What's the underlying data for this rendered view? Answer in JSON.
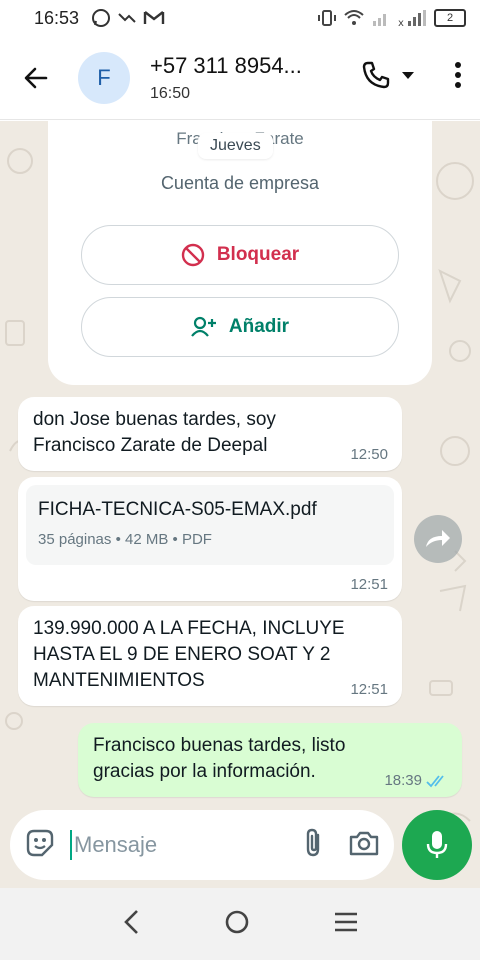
{
  "status_bar": {
    "time": "16:53",
    "battery": "2"
  },
  "header": {
    "avatar_initial": "F",
    "contact_name": "+57 311 8954...",
    "last_seen": "16:50"
  },
  "info_card": {
    "name": "Francisco Zarate",
    "date_chip": "Jueves",
    "account_type": "Cuenta de empresa",
    "block_label": "Bloquear",
    "add_label": "Añadir"
  },
  "messages": [
    {
      "direction": "in",
      "text_line1": "don Jose buenas tardes, soy",
      "text_line2": "Francisco Zarate de Deepal",
      "time": "12:50"
    },
    {
      "direction": "in",
      "file_name": "FICHA-TECNICA-S05-EMAX.pdf",
      "pages": "35 páginas",
      "size": "42 MB",
      "type": "PDF",
      "time": "12:51"
    },
    {
      "direction": "in",
      "text_line1": "139.990.000 A LA FECHA, INCLUYE",
      "text_line2": "HASTA EL 9 DE ENERO SOAT Y 2",
      "text_line3": "MANTENIMIENTOS",
      "time": "12:51"
    },
    {
      "direction": "out",
      "text_line1": "Francisco buenas tardes, listo",
      "text_line2": "gracias por la información.",
      "time": "18:39",
      "status": "read"
    }
  ],
  "composer": {
    "placeholder": "Mensaje"
  },
  "colors": {
    "accent_green": "#1da851",
    "outgoing_bubble": "#d9fdd3",
    "block_red": "#d22f4e",
    "add_green": "#008069",
    "read_ticks": "#53bdeb"
  }
}
